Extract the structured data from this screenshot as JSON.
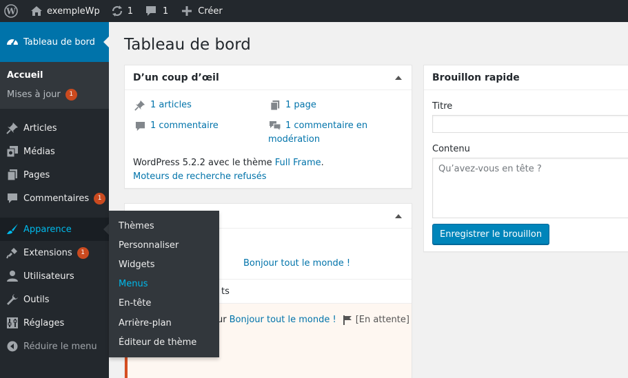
{
  "adminbar": {
    "site_name": "exempleWp",
    "updates_count": "1",
    "comments_count": "1",
    "new_label": "Créer"
  },
  "sidebar": {
    "dashboard_label": "Tableau de bord",
    "submenu": {
      "home": "Accueil",
      "updates": "Mises à jour",
      "updates_badge": "1"
    },
    "items": [
      {
        "label": "Articles",
        "icon": "pin-icon"
      },
      {
        "label": "Médias",
        "icon": "media-icon"
      },
      {
        "label": "Pages",
        "icon": "pages-icon"
      },
      {
        "label": "Commentaires",
        "icon": "comment-icon",
        "badge": "1"
      },
      {
        "label": "Apparence",
        "icon": "brush-icon"
      },
      {
        "label": "Extensions",
        "icon": "plugin-icon",
        "badge": "1"
      },
      {
        "label": "Utilisateurs",
        "icon": "user-icon"
      },
      {
        "label": "Outils",
        "icon": "wrench-icon"
      },
      {
        "label": "Réglages",
        "icon": "settings-icon"
      }
    ],
    "collapse_label": "Réduire le menu"
  },
  "flyout": {
    "items": [
      "Thèmes",
      "Personnaliser",
      "Widgets",
      "Menus",
      "En-tête",
      "Arrière-plan",
      "Éditeur de thème"
    ],
    "active_index": 3
  },
  "page": {
    "title": "Tableau de bord"
  },
  "glance": {
    "title": "D’un coup d’œil",
    "posts": "1 articles",
    "pages": "1 page",
    "comments": "1 commentaire",
    "moderation": "1 commentaire en modération",
    "wp_text": "WordPress 5.2.2 avec le thème ",
    "theme_link": "Full Frame",
    "period": ".",
    "search_engines": "Moteurs de recherche refusés"
  },
  "activity": {
    "post_link": "Bonjour tout le monde !",
    "comments_heading_fragment": "ts",
    "comment_prefix_fragment": "ur",
    "comment_post_link": "Bonjour tout le monde !",
    "pending": "[En attente]"
  },
  "quick_draft": {
    "title": "Brouillon rapide",
    "title_label": "Titre",
    "content_label": "Contenu",
    "content_placeholder": "Qu’avez-vous en tête ?",
    "save_button": "Enregistrer le brouillon"
  },
  "colors": {
    "accent": "#0073aa",
    "bar": "#23282d",
    "badge": "#ca4a1f",
    "hover": "#00b9eb"
  }
}
